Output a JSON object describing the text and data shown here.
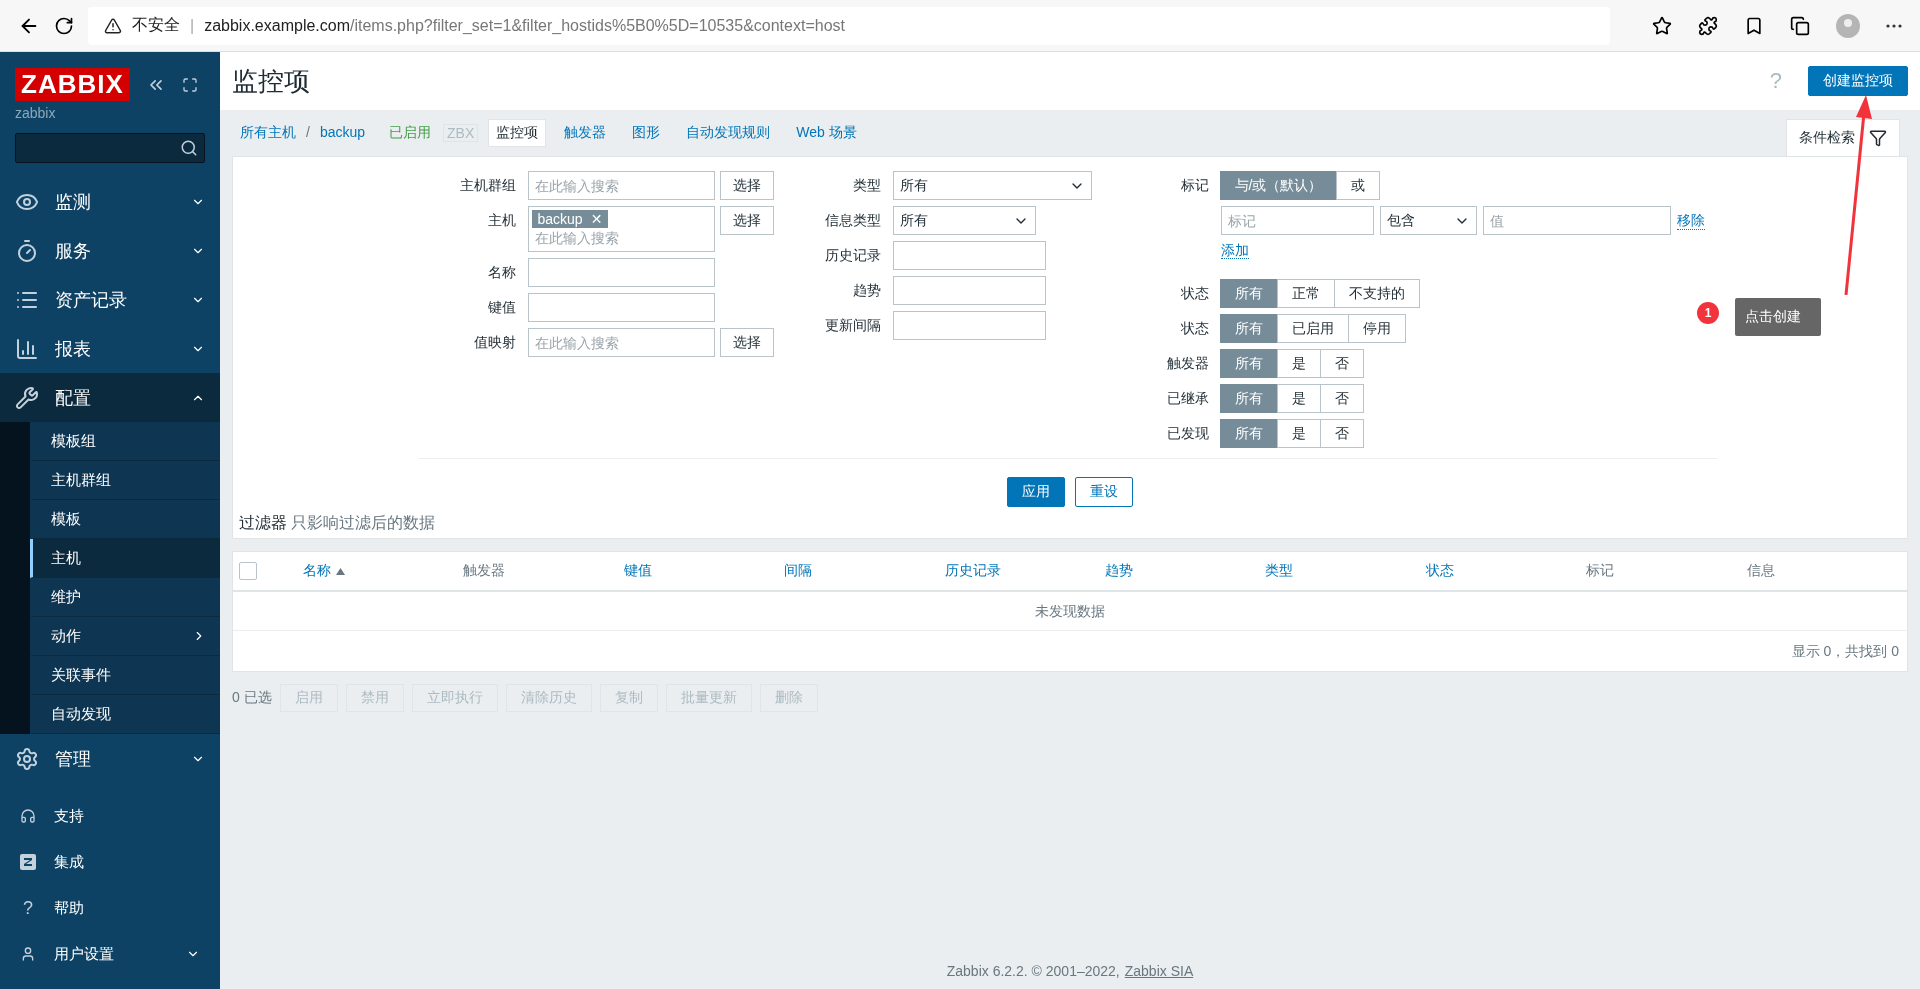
{
  "browser": {
    "security": "不安全",
    "separator": "|",
    "url_host": "zabbix.example.com",
    "url_path": "/items.php?filter_set=1&filter_hostids%5B0%5D=10535&context=host"
  },
  "sidebar": {
    "logo": "ZABBIX",
    "server": "zabbix",
    "menu": [
      {
        "label": "监测",
        "expanded": false
      },
      {
        "label": "服务",
        "expanded": false
      },
      {
        "label": "资产记录",
        "expanded": false
      },
      {
        "label": "报表",
        "expanded": false
      },
      {
        "label": "配置",
        "expanded": true,
        "children": [
          {
            "label": "模板组",
            "selected": false,
            "submenu": false
          },
          {
            "label": "主机群组",
            "selected": false,
            "submenu": false
          },
          {
            "label": "模板",
            "selected": false,
            "submenu": false
          },
          {
            "label": "主机",
            "selected": true,
            "submenu": false
          },
          {
            "label": "维护",
            "selected": false,
            "submenu": false
          },
          {
            "label": "动作",
            "selected": false,
            "submenu": true
          },
          {
            "label": "关联事件",
            "selected": false,
            "submenu": false
          },
          {
            "label": "自动发现",
            "selected": false,
            "submenu": false
          }
        ]
      },
      {
        "label": "管理",
        "expanded": false
      }
    ],
    "bottom": [
      {
        "label": "支持",
        "expandable": false
      },
      {
        "label": "集成",
        "expandable": false
      },
      {
        "label": "帮助",
        "glyph": "?",
        "expandable": false
      },
      {
        "label": "用户设置",
        "expandable": true
      }
    ]
  },
  "header": {
    "title": "监控项",
    "help": "?",
    "create_button": "创建监控项"
  },
  "nav": {
    "breadcrumb": [
      "所有主机",
      "backup"
    ],
    "separator": "/",
    "status": "已启用",
    "agent": "ZBX",
    "tabs": [
      {
        "label": "监控项",
        "selected": true
      },
      {
        "label": "触发器",
        "selected": false
      },
      {
        "label": "图形",
        "selected": false
      },
      {
        "label": "自动发现规则",
        "selected": false
      },
      {
        "label": "Web 场景",
        "selected": false
      }
    ],
    "filter_tab": "条件检索"
  },
  "filter": {
    "left": [
      {
        "kind": "select",
        "label": "主机群组",
        "placeholder": "在此输入搜索",
        "button": "选择"
      },
      {
        "kind": "multi",
        "label": "主机",
        "chips": [
          "backup"
        ],
        "chip_remove": "✕",
        "placeholder": "在此输入搜索",
        "button": "选择"
      },
      {
        "kind": "input",
        "label": "名称"
      },
      {
        "kind": "input",
        "label": "键值"
      },
      {
        "kind": "select",
        "label": "值映射",
        "placeholder": "在此输入搜索",
        "button": "选择"
      }
    ],
    "middle": [
      {
        "kind": "dropdown",
        "label": "类型",
        "value": "所有",
        "wide": true
      },
      {
        "kind": "dropdown",
        "label": "信息类型",
        "value": "所有",
        "wide": false
      },
      {
        "kind": "input",
        "label": "历史记录"
      },
      {
        "kind": "input",
        "label": "趋势"
      },
      {
        "kind": "input",
        "label": "更新间隔"
      }
    ],
    "tags": {
      "label": "标记",
      "operators": [
        {
          "label": "与/或（默认）",
          "selected": true
        },
        {
          "label": "或",
          "selected": false
        }
      ],
      "tag_placeholder": "标记",
      "condition": "包含",
      "value_placeholder": "值",
      "remove": "移除",
      "add": "添加"
    },
    "radios": [
      {
        "label": "状态",
        "options": [
          {
            "label": "所有",
            "selected": true
          },
          {
            "label": "正常",
            "selected": false
          },
          {
            "label": "不支持的",
            "selected": false
          }
        ]
      },
      {
        "label": "状态",
        "options": [
          {
            "label": "所有",
            "selected": true
          },
          {
            "label": "已启用",
            "selected": false
          },
          {
            "label": "停用",
            "selected": false
          }
        ]
      },
      {
        "label": "触发器",
        "options": [
          {
            "label": "所有",
            "selected": true
          },
          {
            "label": "是",
            "selected": false
          },
          {
            "label": "否",
            "selected": false
          }
        ]
      },
      {
        "label": "已继承",
        "options": [
          {
            "label": "所有",
            "selected": true
          },
          {
            "label": "是",
            "selected": false
          },
          {
            "label": "否",
            "selected": false
          }
        ]
      },
      {
        "label": "已发现",
        "options": [
          {
            "label": "所有",
            "selected": true
          },
          {
            "label": "是",
            "selected": false
          },
          {
            "label": "否",
            "selected": false
          }
        ]
      }
    ],
    "apply": "应用",
    "reset": "重设",
    "note_title": "过滤器",
    "note": "只影响过滤后的数据"
  },
  "table": {
    "checked": false,
    "columns": [
      {
        "label": "名称",
        "sortable": true,
        "sorted": true
      },
      {
        "label": "触发器",
        "sortable": false,
        "sorted": false
      },
      {
        "label": "键值",
        "sortable": true,
        "sorted": false
      },
      {
        "label": "间隔",
        "sortable": true,
        "sorted": false
      },
      {
        "label": "历史记录",
        "sortable": true,
        "sorted": false
      },
      {
        "label": "趋势",
        "sortable": true,
        "sorted": false
      },
      {
        "label": "类型",
        "sortable": true,
        "sorted": false
      },
      {
        "label": "状态",
        "sortable": true,
        "sorted": false
      },
      {
        "label": "标记",
        "sortable": false,
        "sorted": false
      },
      {
        "label": "信息",
        "sortable": false,
        "sorted": false
      }
    ],
    "empty": "未发现数据",
    "count": "显示 0，共找到 0"
  },
  "actions": {
    "selected": "0 已选",
    "buttons": [
      {
        "label": "启用",
        "disabled": true
      },
      {
        "label": "禁用",
        "disabled": true
      },
      {
        "label": "立即执行",
        "disabled": true
      },
      {
        "label": "清除历史",
        "disabled": true
      },
      {
        "label": "复制",
        "disabled": true
      },
      {
        "label": "批量更新",
        "disabled": true
      },
      {
        "label": "删除",
        "disabled": true
      }
    ]
  },
  "footer": {
    "text": "Zabbix 6.2.2. © 2001–2022,",
    "link": "Zabbix SIA"
  },
  "annotation": {
    "number": "1",
    "text": "点击创建"
  }
}
